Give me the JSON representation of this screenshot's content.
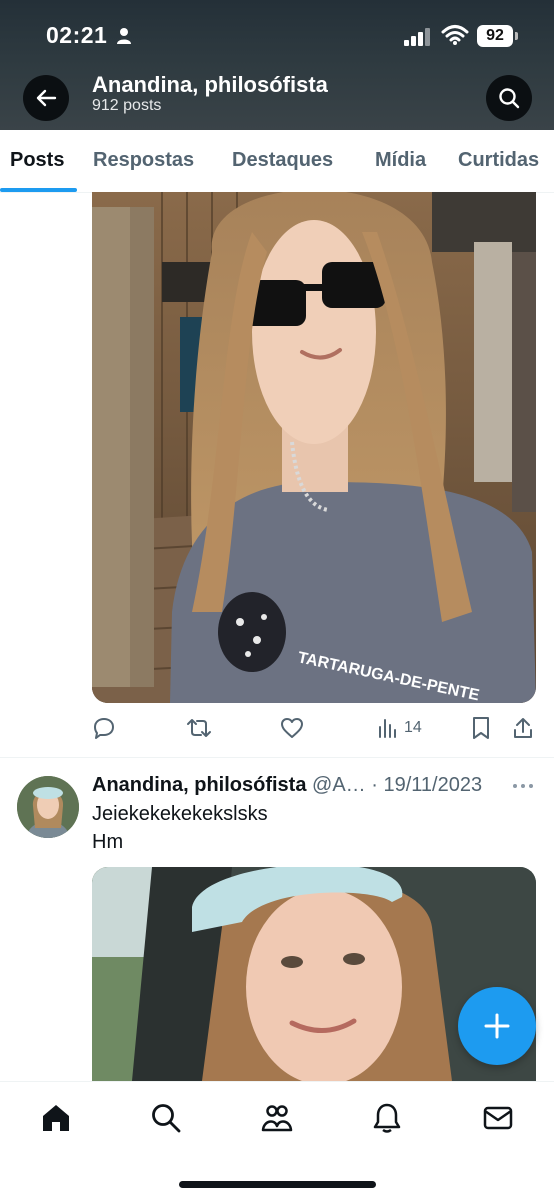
{
  "status_bar": {
    "time": "02:21",
    "battery": "92"
  },
  "header": {
    "title": "Anandina, philosófista",
    "subtitle": "912 posts"
  },
  "tabs": [
    {
      "label": "Posts"
    },
    {
      "label": "Respostas"
    },
    {
      "label": "Destaques"
    },
    {
      "label": "Mídia"
    },
    {
      "label": "Curtidas"
    }
  ],
  "post1": {
    "image_description": "selfie with sunglasses and Tartaruga-de-Pente t-shirt",
    "shirt_text": "TARTARUGA-DE-PENTE",
    "views": "14"
  },
  "post2": {
    "author_name": "Anandina, philosófista",
    "handle": "@A…",
    "separator": "·",
    "date": "19/11/2023",
    "text_line1": "Jeiekekekekekslsks",
    "text_line2": "Hm"
  },
  "colors": {
    "accent": "#1d9bf0",
    "text": "#0f1419",
    "muted": "#536471",
    "header_bg": "#2e3a40"
  },
  "icons": [
    "back-arrow-icon",
    "search-icon",
    "reply-icon",
    "retweet-icon",
    "like-icon",
    "views-icon",
    "bookmark-icon",
    "share-icon",
    "more-icon",
    "plus-icon",
    "home-icon",
    "explore-icon",
    "communities-icon",
    "notifications-icon",
    "messages-icon"
  ]
}
